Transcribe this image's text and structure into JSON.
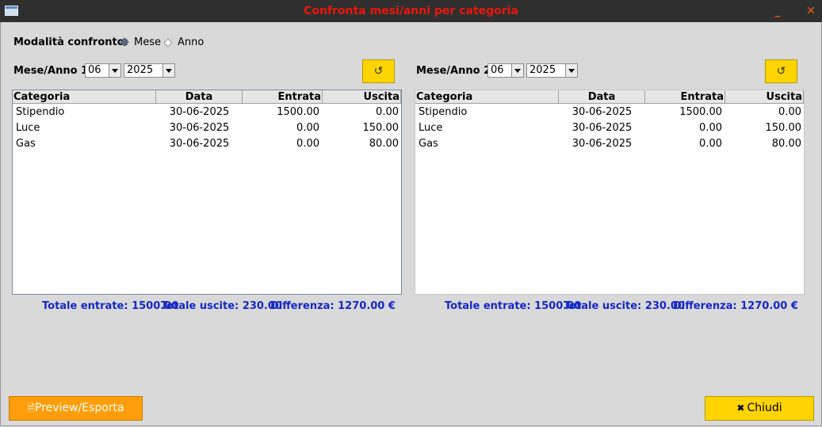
{
  "window": {
    "title": "Confronta mesi/anni per categoria",
    "minimize_glyph": "_",
    "close_glyph": "✕"
  },
  "mode": {
    "label": "Modalità confronto:",
    "options": [
      {
        "label": "Mese",
        "selected": true
      },
      {
        "label": "Anno",
        "selected": false
      }
    ]
  },
  "panels": [
    {
      "label": "Mese/Anno 1",
      "month": "06",
      "year": "2025",
      "refresh_glyph": "↺",
      "columns": [
        "Categoria",
        "Data",
        "Entrata",
        "Uscita"
      ],
      "rows": [
        [
          "Stipendio",
          "30-06-2025",
          "1500.00",
          "0.00"
        ],
        [
          "Luce",
          "30-06-2025",
          "0.00",
          "150.00"
        ],
        [
          "Gas",
          "30-06-2025",
          "0.00",
          "80.00"
        ]
      ],
      "totals": {
        "entrate": "Totale entrate: 1500.00",
        "uscite": "Totale uscite: 230.00",
        "differenza": "Differenza: 1270.00 €"
      }
    },
    {
      "label": "Mese/Anno 2",
      "month": "06",
      "year": "2025",
      "refresh_glyph": "↺",
      "columns": [
        "Categoria",
        "Data",
        "Entrata",
        "Uscita"
      ],
      "rows": [
        [
          "Stipendio",
          "30-06-2025",
          "1500.00",
          "0.00"
        ],
        [
          "Luce",
          "30-06-2025",
          "0.00",
          "150.00"
        ],
        [
          "Gas",
          "30-06-2025",
          "0.00",
          "80.00"
        ]
      ],
      "totals": {
        "entrate": "Totale entrate: 1500.00",
        "uscite": "Totale uscite: 230.00",
        "differenza": "Differenza: 1270.00 €"
      }
    }
  ],
  "buttons": {
    "preview_icon": "🗎",
    "preview_label": "Preview/Esporta",
    "close_icon": "✖",
    "close_label": "Chiudi"
  },
  "colors": {
    "title": "#e8160c",
    "totals": "#1428c8",
    "accent_yellow": "#ffd400",
    "accent_orange": "#ff9e0a"
  }
}
